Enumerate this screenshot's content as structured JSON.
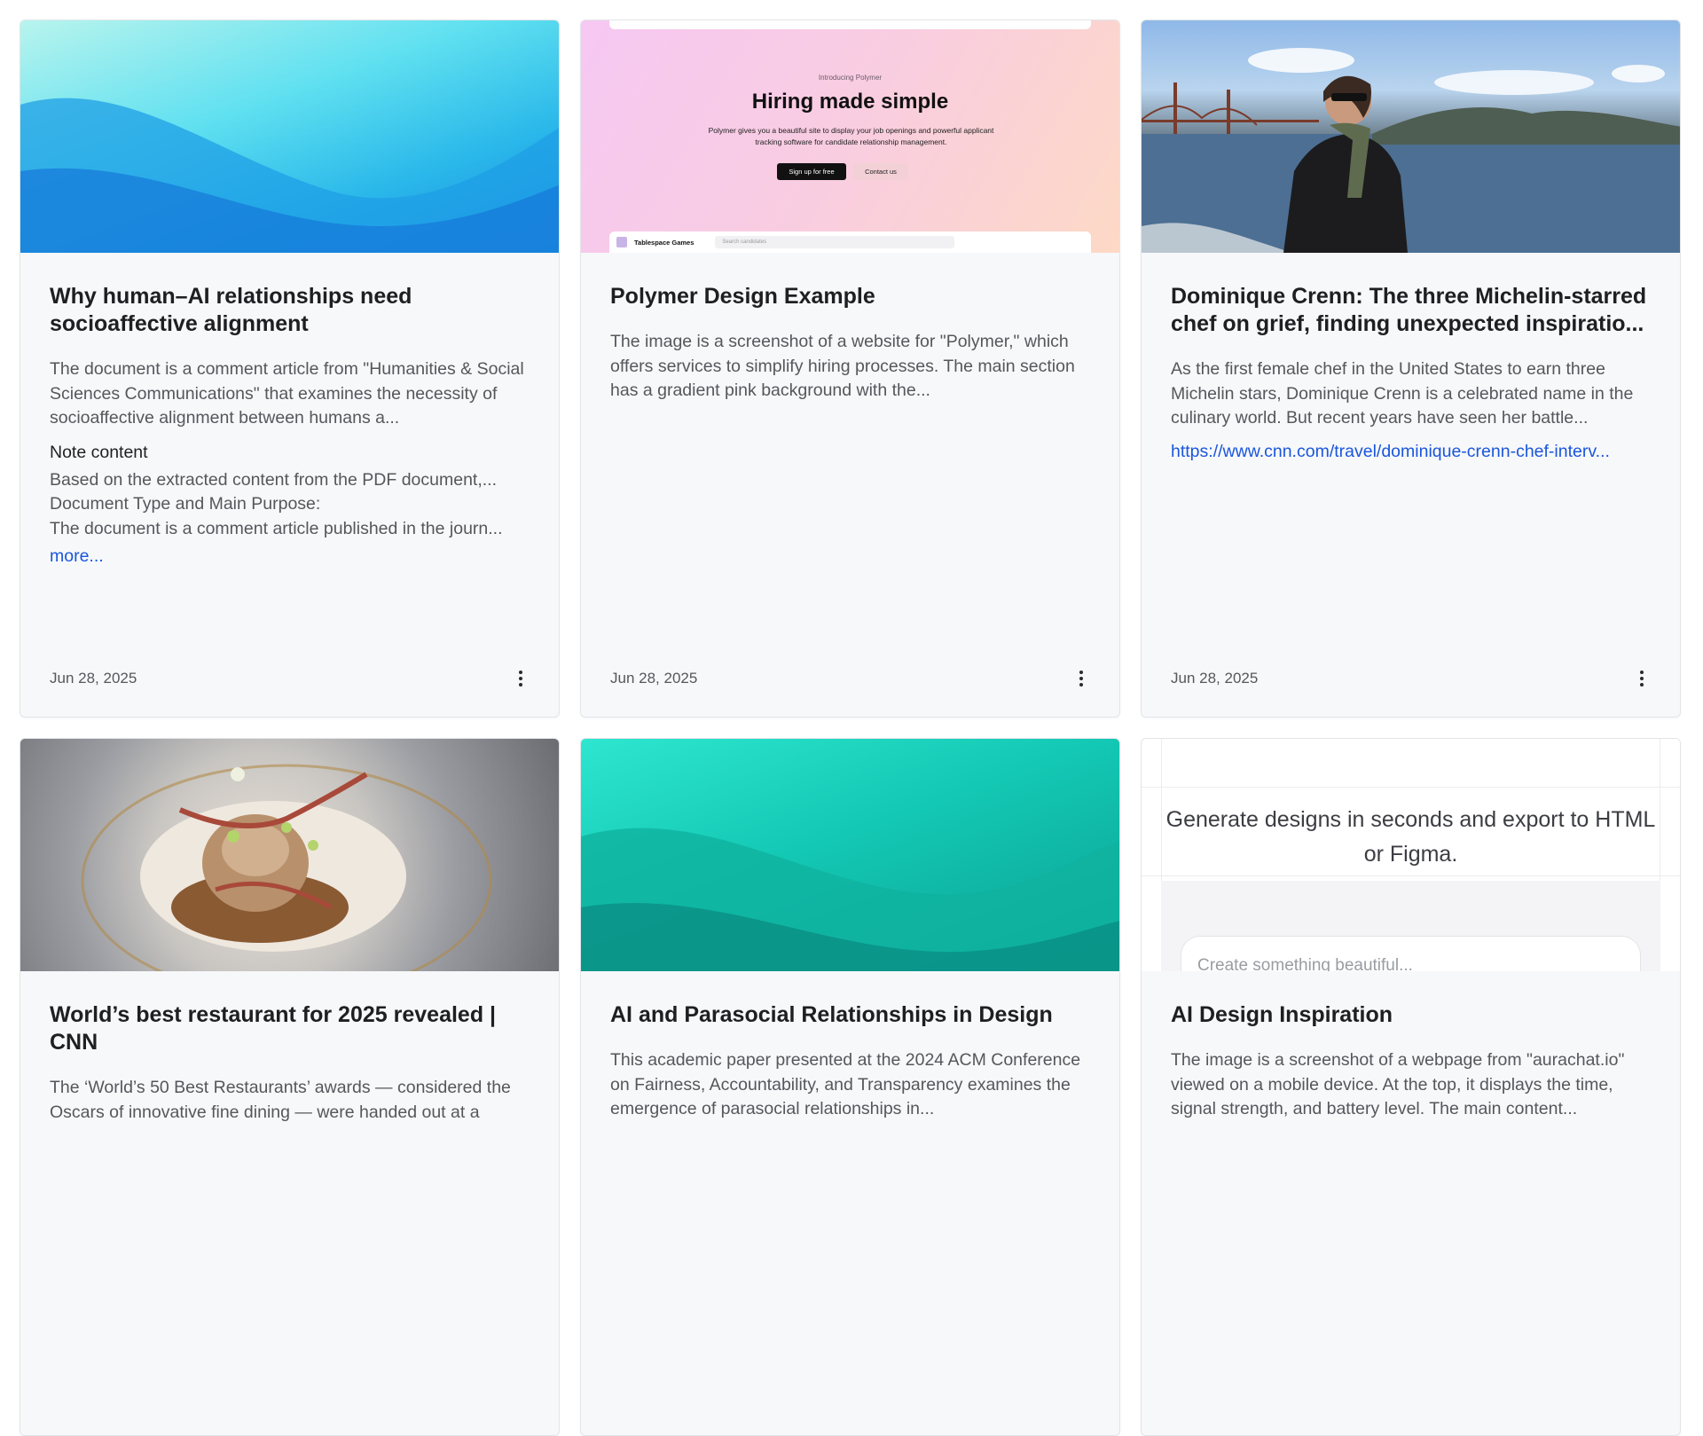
{
  "cards": [
    {
      "title": "Why human–AI relationships need socioaffective alignment",
      "description": "The document is a comment article from \"Humanities & Social Sciences Communications\" that examines the necessity of socioaffective alignment between humans a...",
      "note_heading": "Note content",
      "note_lines": [
        "Based on the extracted content from the PDF document,...",
        "Document Type and Main Purpose:",
        "The document is a comment article published in the journ..."
      ],
      "more_label": "more...",
      "date": "Jun 28, 2025",
      "thumbnail": "blue-wave"
    },
    {
      "title": "Polymer Design Example",
      "description": "The image is a screenshot of a website for \"Polymer,\" which offers services to simplify hiring processes. The main section has a gradient pink background with the...",
      "date": "Jun 28, 2025",
      "thumbnail": "polymer-site",
      "preview": {
        "eyebrow": "Introducing Polymer",
        "headline": "Hiring made simple",
        "subtext": "Polymer gives you a beautiful site to display your job openings and powerful applicant tracking software for candidate relationship management.",
        "primary_btn": "Sign up for free",
        "secondary_btn": "Contact us",
        "app_name": "Tablespace Games",
        "search_placeholder": "Search candidates"
      }
    },
    {
      "title": "Dominique Crenn: The three Michelin-starred chef on grief, finding unexpected inspiratio...",
      "description": "As the first female chef in the United States to earn three Michelin stars, Dominique Crenn is a celebrated name in the culinary world. But recent years have seen her battle...",
      "link": "https://www.cnn.com/travel/dominique-crenn-chef-interv...",
      "date": "Jun 28, 2025",
      "thumbnail": "person-golden-gate"
    },
    {
      "title": "World’s best restaurant for 2025 revealed | CNN",
      "description": "The ‘World’s 50 Best Restaurants’ awards — considered the Oscars of innovative fine dining — were handed out at a",
      "thumbnail": "plated-dish"
    },
    {
      "title": "AI and Parasocial Relationships in Design",
      "description": "This academic paper presented at the 2024 ACM Conference on Fairness, Accountability, and Transparency examines the emergence of parasocial relationships in...",
      "thumbnail": "teal-wave"
    },
    {
      "title": "AI Design Inspiration",
      "description": "The image is a screenshot of a webpage from \"aurachat.io\" viewed on a mobile device. At the top, it displays the time, signal strength, and battery level. The main content...",
      "thumbnail": "aurachat-screenshot",
      "preview": {
        "headline": "Generate designs in seconds and export to HTML or Figma.",
        "input_placeholder": "Create something beautiful..."
      }
    }
  ],
  "colors": {
    "link": "#1a56db",
    "card_bg": "#f7f8fa"
  }
}
